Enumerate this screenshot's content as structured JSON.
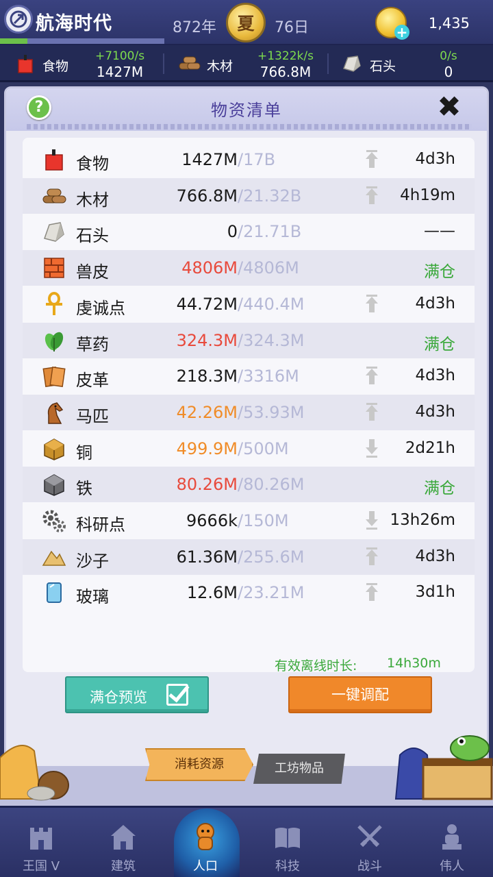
{
  "topbar": {
    "title": "航海时代",
    "year": "872年",
    "season": "夏",
    "day": "76日",
    "coins": "1,435"
  },
  "resource_strip": [
    {
      "label": "食物",
      "rate": "+7100/s",
      "amount": "1427M"
    },
    {
      "label": "木材",
      "rate": "+1322k/s",
      "amount": "766.8M"
    },
    {
      "label": "石头",
      "rate": "0/s",
      "amount": "0"
    }
  ],
  "panel": {
    "title": "物资清单",
    "help": "?",
    "close": "✖"
  },
  "resources": [
    {
      "name": "食物",
      "icon": "food-icon",
      "current": "1427M",
      "max": "/17B",
      "status": "black",
      "arrow": "up",
      "time": "4d3h"
    },
    {
      "name": "木材",
      "icon": "wood-icon",
      "current": "766.8M",
      "max": "/21.32B",
      "status": "black",
      "arrow": "up",
      "time": "4h19m"
    },
    {
      "name": "石头",
      "icon": "stone-icon",
      "current": "0",
      "max": "/21.71B",
      "status": "black",
      "arrow": "none",
      "time": "——"
    },
    {
      "name": "兽皮",
      "icon": "hide-icon",
      "current": "4806M",
      "max": "/4806M",
      "status": "red",
      "arrow": "none",
      "time": "满仓"
    },
    {
      "name": "虔诚点",
      "icon": "ankh-icon",
      "current": "44.72M",
      "max": "/440.4M",
      "status": "black",
      "arrow": "up",
      "time": "4d3h"
    },
    {
      "name": "草药",
      "icon": "herb-icon",
      "current": "324.3M",
      "max": "/324.3M",
      "status": "red",
      "arrow": "none",
      "time": "满仓"
    },
    {
      "name": "皮革",
      "icon": "leather-icon",
      "current": "218.3M",
      "max": "/3316M",
      "status": "black",
      "arrow": "up",
      "time": "4d3h"
    },
    {
      "name": "马匹",
      "icon": "horse-icon",
      "current": "42.26M",
      "max": "/53.93M",
      "status": "orange",
      "arrow": "up",
      "time": "4d3h"
    },
    {
      "name": "铜",
      "icon": "copper-icon",
      "current": "499.9M",
      "max": "/500M",
      "status": "orange",
      "arrow": "down",
      "time": "2d21h"
    },
    {
      "name": "铁",
      "icon": "iron-icon",
      "current": "80.26M",
      "max": "/80.26M",
      "status": "red",
      "arrow": "none",
      "time": "满仓"
    },
    {
      "name": "科研点",
      "icon": "gears-icon",
      "current": "9666k",
      "max": "/150M",
      "status": "black",
      "arrow": "down",
      "time": "13h26m"
    },
    {
      "name": "沙子",
      "icon": "sand-icon",
      "current": "61.36M",
      "max": "/255.6M",
      "status": "black",
      "arrow": "up",
      "time": "4d3h"
    },
    {
      "name": "玻璃",
      "icon": "glass-icon",
      "current": "12.6M",
      "max": "/23.21M",
      "status": "black",
      "arrow": "up",
      "time": "3d1h"
    }
  ],
  "offline": {
    "label": "有效离线时长:",
    "value": "14h30m"
  },
  "buttons": {
    "preview": "满仓预览",
    "allocate": "一键调配"
  },
  "tabs": {
    "consume": "消耗资源",
    "workshop": "工坊物品"
  },
  "nav": [
    {
      "label": "王国 V",
      "icon": "castle-icon"
    },
    {
      "label": "建筑",
      "icon": "house-icon"
    },
    {
      "label": "人口",
      "icon": "people-icon",
      "active": true
    },
    {
      "label": "科技",
      "icon": "book-icon"
    },
    {
      "label": "战斗",
      "icon": "swords-icon"
    },
    {
      "label": "伟人",
      "icon": "statue-icon"
    }
  ],
  "colors": {
    "red": "#e84a3c",
    "orange": "#f08c28",
    "green": "#3aa83a",
    "max_grey": "#b5b8d6"
  }
}
